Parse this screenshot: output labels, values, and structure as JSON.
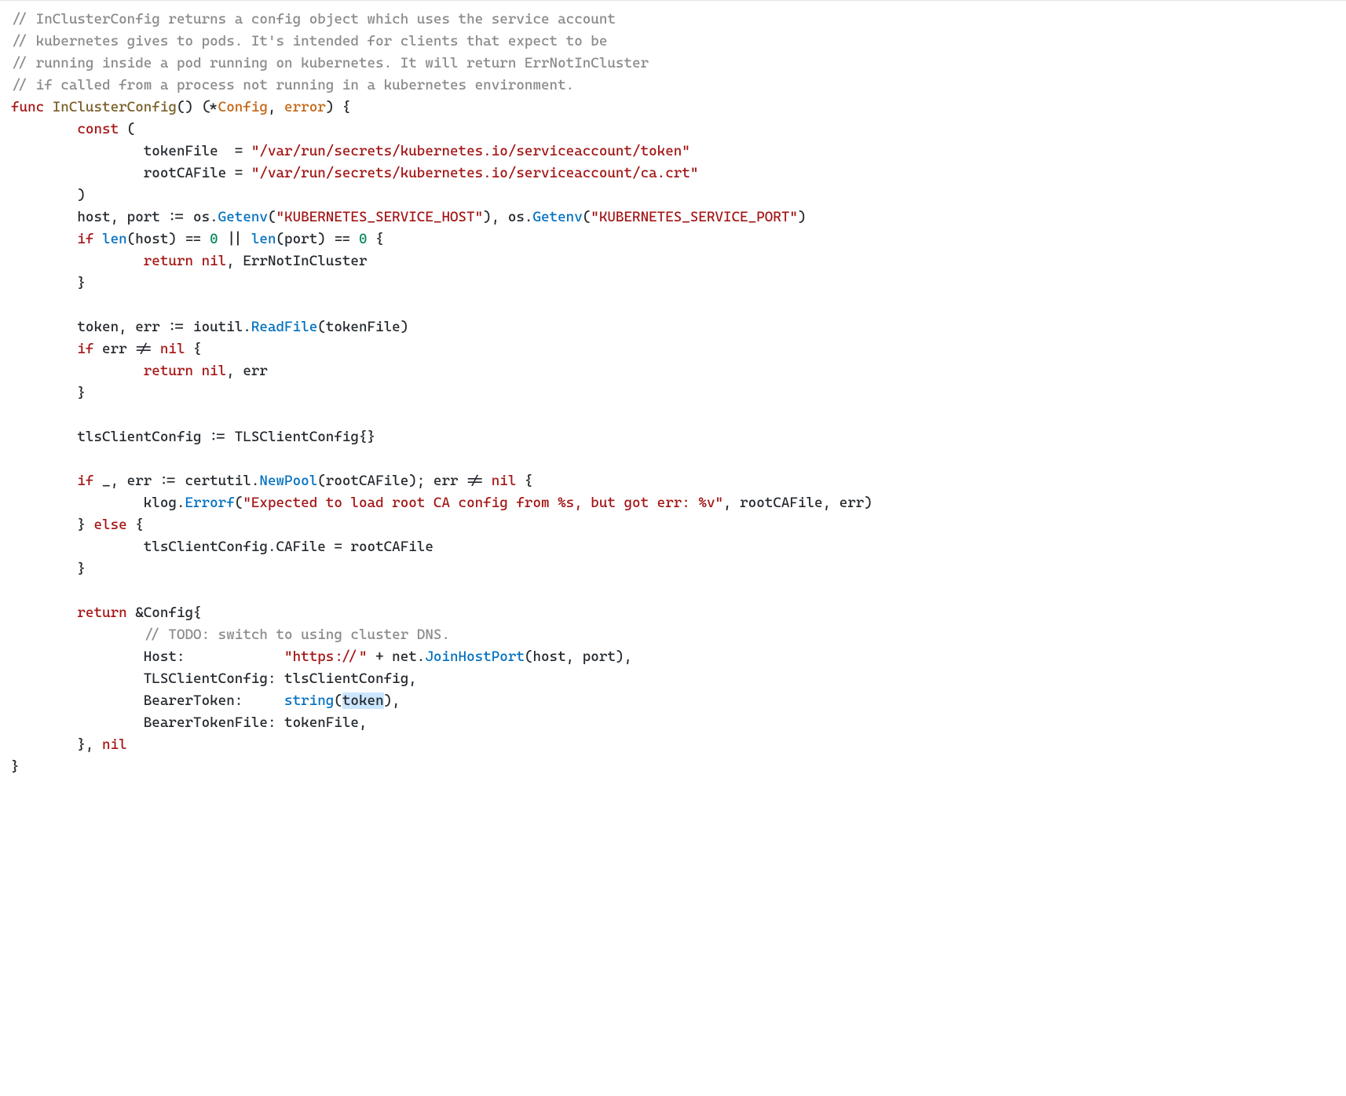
{
  "code": {
    "l1": "// InClusterConfig returns a config object which uses the service account",
    "l2": "// kubernetes gives to pods. It's intended for clients that expect to be",
    "l3": "// running inside a pod running on kubernetes. It will return ErrNotInCluster",
    "l4": "// if called from a process not running in a kubernetes environment.",
    "l5a": "func",
    "l5b": "InClusterConfig",
    "l5c": "() (*",
    "l5d": "Config",
    "l5e": ", ",
    "l5f": "error",
    "l5g": ") {",
    "l6a": "        ",
    "l6b": "const",
    "l6c": " (",
    "l7a": "                tokenFile  = ",
    "l7b": "\"/var/run/secrets/kubernetes.io/serviceaccount/token\"",
    "l8a": "                rootCAFile = ",
    "l8b": "\"/var/run/secrets/kubernetes.io/serviceaccount/ca.crt\"",
    "l9": "        )",
    "l10a": "        host, port := os.",
    "l10b": "Getenv",
    "l10c": "(",
    "l10d": "\"KUBERNETES_SERVICE_HOST\"",
    "l10e": "), os.",
    "l10f": "Getenv",
    "l10g": "(",
    "l10h": "\"KUBERNETES_SERVICE_PORT\"",
    "l10i": ")",
    "l11a": "        ",
    "l11b": "if",
    "l11c": " ",
    "l11d": "len",
    "l11e": "(host) == ",
    "l11f": "0",
    "l11g": " || ",
    "l11h": "len",
    "l11i": "(port) == ",
    "l11j": "0",
    "l11k": " {",
    "l12a": "                ",
    "l12b": "return",
    "l12c": " ",
    "l12d": "nil",
    "l12e": ", ErrNotInCluster",
    "l13": "        }",
    "l15a": "        token, err := ioutil.",
    "l15b": "ReadFile",
    "l15c": "(tokenFile)",
    "l16a": "        ",
    "l16b": "if",
    "l16c": " err != ",
    "l16d": "nil",
    "l16e": " {",
    "l17a": "                ",
    "l17b": "return",
    "l17c": " ",
    "l17d": "nil",
    "l17e": ", err",
    "l18": "        }",
    "l20": "        tlsClientConfig := TLSClientConfig{}",
    "l22a": "        ",
    "l22b": "if",
    "l22c": " _, err := certutil.",
    "l22d": "NewPool",
    "l22e": "(rootCAFile); err != ",
    "l22f": "nil",
    "l22g": " {",
    "l23a": "                klog.",
    "l23b": "Errorf",
    "l23c": "(",
    "l23d": "\"Expected to load root CA config from %s, but got err: %v\"",
    "l23e": ", rootCAFile, err)",
    "l24a": "        } ",
    "l24b": "else",
    "l24c": " {",
    "l25": "                tlsClientConfig.CAFile = rootCAFile",
    "l26": "        }",
    "l28a": "        ",
    "l28b": "return",
    "l28c": " &Config{",
    "l29a": "                ",
    "l29b": "// TODO: switch to using cluster DNS.",
    "l30a": "                Host:            ",
    "l30b": "\"https://\"",
    "l30c": " + net.",
    "l30d": "JoinHostPort",
    "l30e": "(host, port),",
    "l31": "                TLSClientConfig: tlsClientConfig,",
    "l32a": "                BearerToken:     ",
    "l32b": "string",
    "l32c": "(",
    "l32d": "token",
    "l32e": "),",
    "l33": "                BearerTokenFile: tokenFile,",
    "l34a": "        }, ",
    "l34b": "nil",
    "l35": "}"
  }
}
